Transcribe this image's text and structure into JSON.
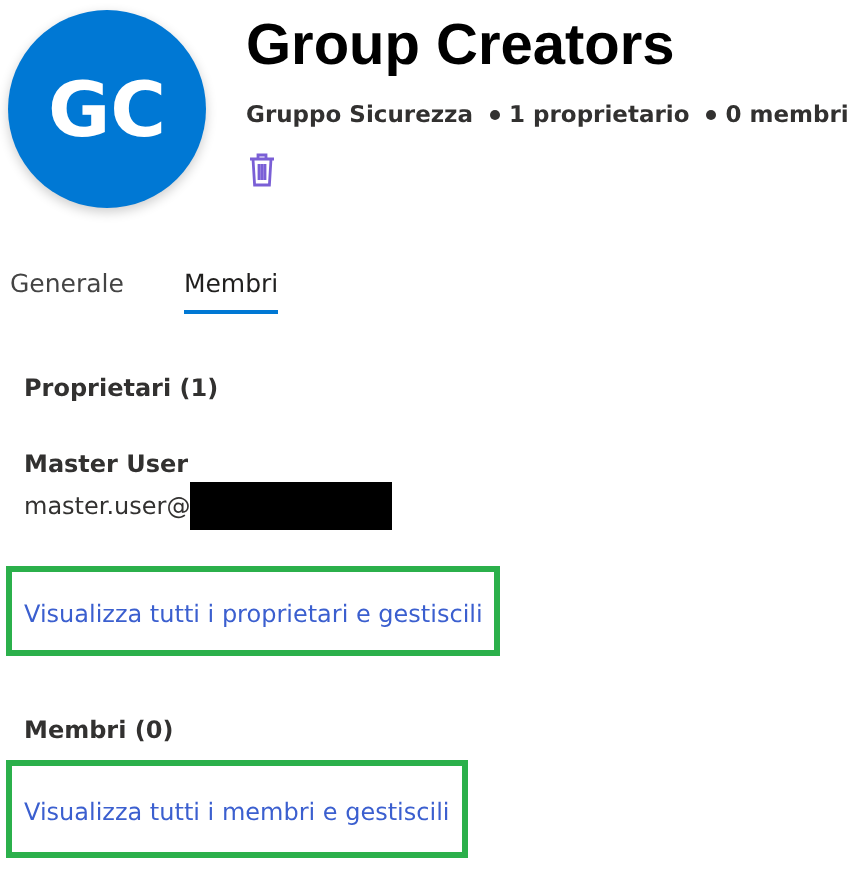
{
  "group": {
    "initials": "GC",
    "title": "Group Creators",
    "type": "Gruppo Sicurezza",
    "owners_count": "1 proprietario",
    "members_count": "0 membri"
  },
  "tabs": [
    {
      "label": "Generale",
      "selected": false
    },
    {
      "label": "Membri",
      "selected": true
    }
  ],
  "owners": {
    "heading": "Proprietari (1)",
    "user_name": "Master User",
    "user_email": "master.user@",
    "link": "Visualizza tutti i proprietari e gestiscili"
  },
  "members": {
    "heading": "Membri (0)",
    "link": "Visualizza tutti i membri e gestiscili"
  }
}
